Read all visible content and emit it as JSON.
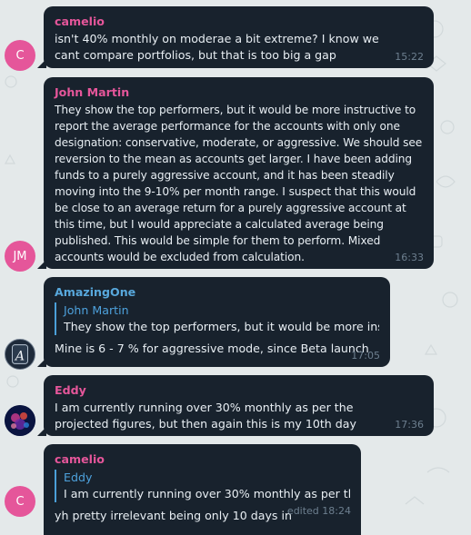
{
  "messages": [
    {
      "sender": "camelio",
      "avatar_initial": "C",
      "text": "isn't 40% monthly on moderae a bit extreme? I know we cant compare portfolios, but that is too big a gap",
      "time": "15:22"
    },
    {
      "sender": "John Martin",
      "avatar_initial": "JM",
      "text": "They show the top performers, but it would be more instructive to report the average performance for the accounts with only one designation: conservative, moderate, or aggressive.  We should see reversion to the mean as accounts get larger.  I have been adding funds to a purely aggressive account, and it has been steadily moving into the 9-10% per month range.  I suspect that this would be close to an average return for a purely aggressive account at this time, but I would appreciate a calculated average being published.  This would be simple for them to perform.  Mixed accounts would be excluded from calculation.",
      "time": "16:33"
    },
    {
      "sender": "AmazingOne",
      "avatar_initial": "A",
      "reply_to": "John Martin",
      "reply_text": "They show the top performers, but it would be more inst...",
      "text": "Mine is 6 - 7 % for aggressive mode, since Beta launch",
      "time": "17:05"
    },
    {
      "sender": "Eddy",
      "avatar_initial": "",
      "text": "I am currently running over 30% monthly as per the projected figures, but then again this is my 10th day",
      "time": "17:36"
    },
    {
      "sender": "camelio",
      "avatar_initial": "C",
      "reply_to": "Eddy",
      "reply_text": "I am currently running over 30% monthly as per th...",
      "text": "yh pretty irrelevant being only 10 days in",
      "time": "edited 18:24"
    }
  ],
  "colors": {
    "background": "#e4e9ea",
    "bubble": "#18222d",
    "text": "#e8eef3",
    "time": "#6d7f8f",
    "name_pink": "#e5569a",
    "name_blue": "#58a8dc",
    "avatar_camelio": "#e5569a",
    "avatar_john": "#e5569a"
  }
}
